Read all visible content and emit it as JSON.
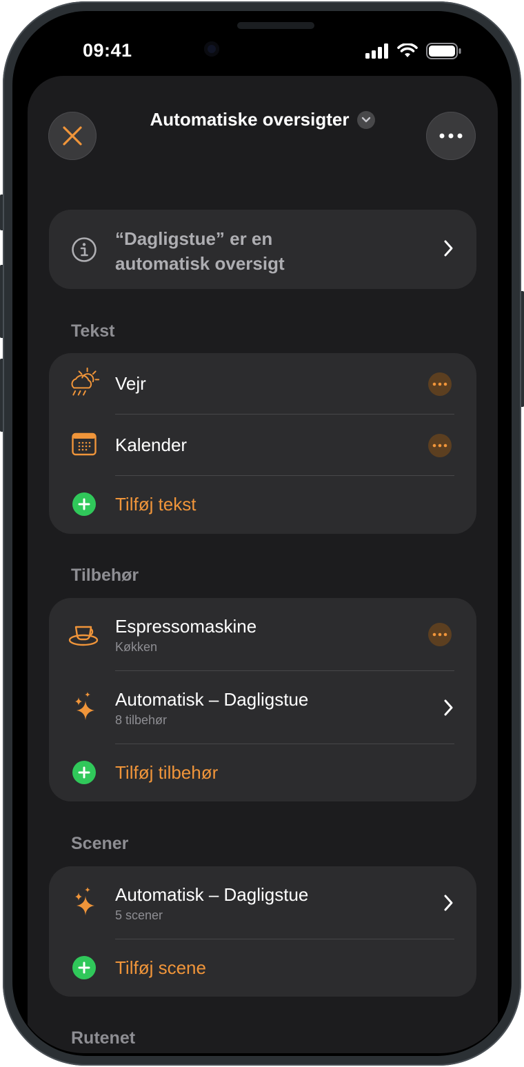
{
  "status_bar": {
    "time": "09:41"
  },
  "header": {
    "title": "Automatiske oversigter"
  },
  "info_banner": {
    "line1": "“Dagligstue” er en",
    "line2": "automatisk oversigt"
  },
  "sections": {
    "tekst": {
      "label": "Tekst",
      "items": [
        {
          "label": "Vejr",
          "icon": "weather-icon"
        },
        {
          "label": "Kalender",
          "icon": "calendar-icon"
        }
      ],
      "add_label": "Tilføj tekst"
    },
    "tilbehor": {
      "label": "Tilbehør",
      "items": [
        {
          "label": "Espressomaskine",
          "sub": "Køkken",
          "icon": "coffee-cup-icon"
        },
        {
          "label": "Automatisk – Dagligstue",
          "sub": "8 tilbehør",
          "icon": "sparkles-icon"
        }
      ],
      "add_label": "Tilføj tilbehør"
    },
    "scener": {
      "label": "Scener",
      "items": [
        {
          "label": "Automatisk – Dagligstue",
          "sub": "5 scener",
          "icon": "sparkles-icon"
        }
      ],
      "add_label": "Tilføj scene"
    },
    "rutenet": {
      "label": "Rutenet"
    }
  },
  "colors": {
    "accent": "#f0953a",
    "add_green": "#30c85a",
    "card": "#2c2c2e",
    "sheet": "#1c1c1e"
  }
}
